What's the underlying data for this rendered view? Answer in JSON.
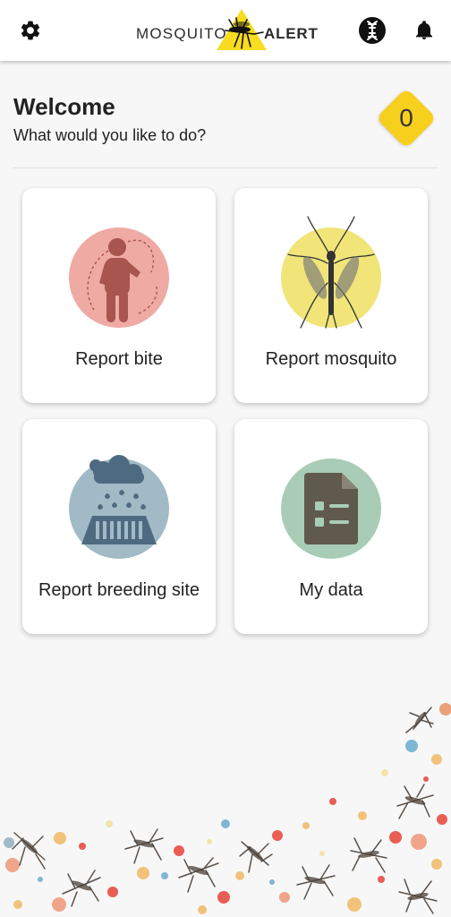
{
  "appbar": {
    "logo_word1": "MOSQUITO",
    "logo_word2": "ALERT",
    "settings_icon": "gear-icon",
    "dna_icon": "dna-icon",
    "notifications_icon": "bell-icon"
  },
  "header": {
    "title": "Welcome",
    "subtitle": "What would you like to do?",
    "points": "0",
    "points_color": "#f7cf1d"
  },
  "actions": [
    {
      "label": "Report bite",
      "icon": "person-bite-icon",
      "color": "#eeaaa3"
    },
    {
      "label": "Report mosquito",
      "icon": "mosquito-icon",
      "color": "#f1e57a"
    },
    {
      "label": "Report breeding site",
      "icon": "rain-drain-icon",
      "color": "#a2bac6"
    },
    {
      "label": "My data",
      "icon": "document-icon",
      "color": "#a9ccb6"
    }
  ]
}
